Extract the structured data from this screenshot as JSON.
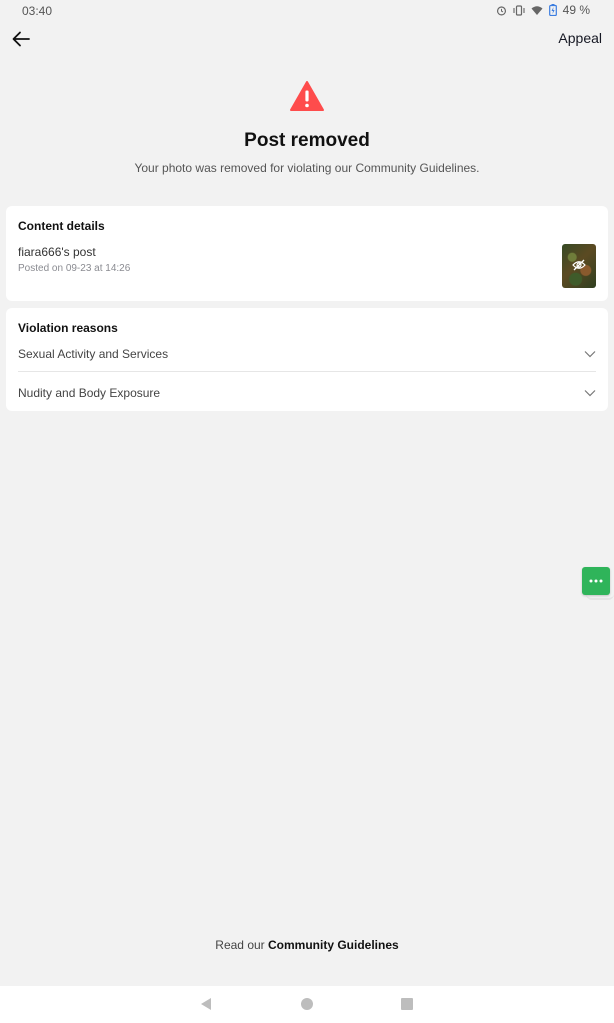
{
  "status_bar": {
    "time": "03:40",
    "battery": "49 %",
    "icons": [
      "alarm-icon",
      "vibrate-icon",
      "wifi-icon",
      "battery-charging-icon"
    ]
  },
  "header": {
    "back_icon": "arrow-left-icon",
    "appeal_label": "Appeal"
  },
  "hero": {
    "icon": "warning-triangle-icon",
    "icon_color": "#fe4c4c",
    "title": "Post removed",
    "subtitle": "Your photo was removed for violating our Community Guidelines."
  },
  "content_details": {
    "title": "Content details",
    "post_owner": "fiara666's post",
    "posted_on": "Posted on 09-23 at 14:26",
    "thumbnail_icon": "eye-off-icon"
  },
  "violations": {
    "title": "Violation reasons",
    "items": [
      {
        "label": "Sexual Activity and Services"
      },
      {
        "label": "Nudity and Body Exposure"
      }
    ]
  },
  "floating_chat": {
    "icon": "more-dots-icon",
    "color": "#2fb45a"
  },
  "footer": {
    "prefix": "Read our ",
    "link": "Community Guidelines"
  },
  "nav": {
    "back_icon": "nav-back-triangle-icon",
    "home_icon": "nav-home-circle-icon",
    "recents_icon": "nav-recents-square-icon"
  }
}
